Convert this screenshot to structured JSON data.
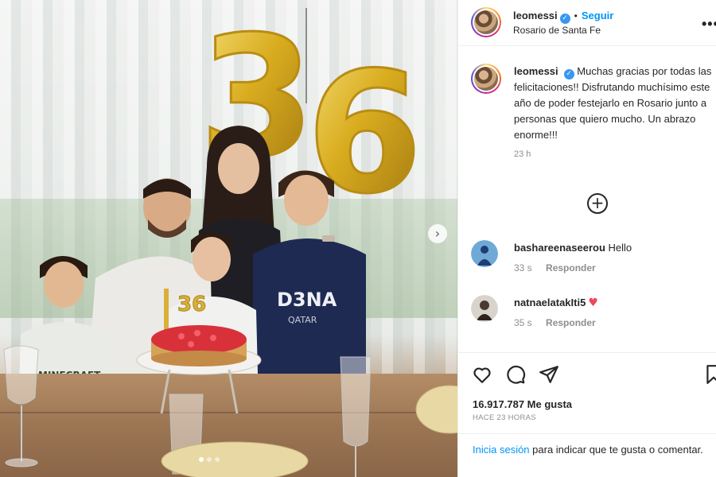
{
  "post": {
    "username": "leomessi",
    "verified_mark": "✓",
    "separator": "•",
    "follow_label": "Seguir",
    "location": "Rosario de Santa Fe",
    "more_label": "•••",
    "caption": "Muchas gracias por todas las felicitaciones!! Disfrutando muchísimo este año de poder festejarlo en Rosario junto a personas que quiero mucho. Un abrazo enorme!!!",
    "caption_time": "23 h",
    "likes": "16.917.787 Me gusta",
    "ago": "HACE 23 HORAS"
  },
  "photo": {
    "balloon_digits": [
      "3",
      "6"
    ],
    "candle_text": "36",
    "shirt_text": "D3NA",
    "shirt_sub": "QATAR",
    "shirt_small": "MINECRAFT"
  },
  "load_more_icon": "plus-circle-icon",
  "comments": [
    {
      "username": "bashareenaseerou",
      "text": "Hello",
      "time": "33 s",
      "reply": "Responder"
    },
    {
      "username": "natnaelatakIti5",
      "text": "",
      "emoji": "♥",
      "time": "35 s",
      "reply": "Responder"
    }
  ],
  "actions": [
    "heart-icon",
    "comment-icon",
    "share-icon",
    "bookmark-icon"
  ],
  "login": {
    "link": "Inicia sesión",
    "rest": " para indicar que te gusta o comentar."
  },
  "colors": {
    "accent_blue": "#0095f6",
    "verified_blue": "#3897f0",
    "heart_red": "#ed4956",
    "balloon_gold": "#e0b826"
  }
}
